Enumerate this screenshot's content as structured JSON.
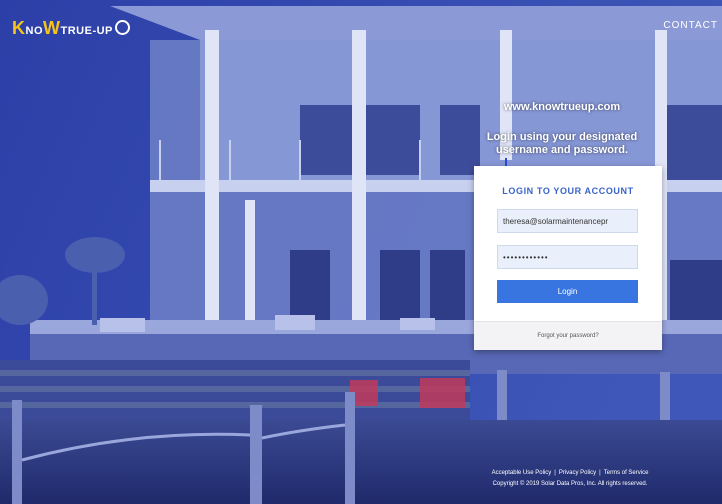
{
  "header": {
    "logo": {
      "k": "K",
      "no": "NO",
      "w": "W",
      "rest": "TRUE-UP"
    },
    "contact_label": "CONTACT"
  },
  "annotation": {
    "url": "www.knowtrueup.com",
    "instruction_line1": "Login using your designated",
    "instruction_line2": "username and password."
  },
  "login": {
    "title": "LOGIN TO YOUR ACCOUNT",
    "email_value": "theresa@solarmaintenancepr",
    "password_value": "••••••••••••",
    "button_label": "Login",
    "forgot_label": "Forgot your password?"
  },
  "footer": {
    "links": [
      "Acceptable Use Policy",
      "Privacy Policy",
      "Terms of Service"
    ],
    "copyright": "Copyright © 2019 Solar Data Pros, Inc. All rights reserved."
  },
  "colors": {
    "overlay": "#27357f",
    "accent_yellow": "#f6c417",
    "card_title": "#3a64c8",
    "button": "#3975e0",
    "field_bg": "#eaf0fb"
  }
}
